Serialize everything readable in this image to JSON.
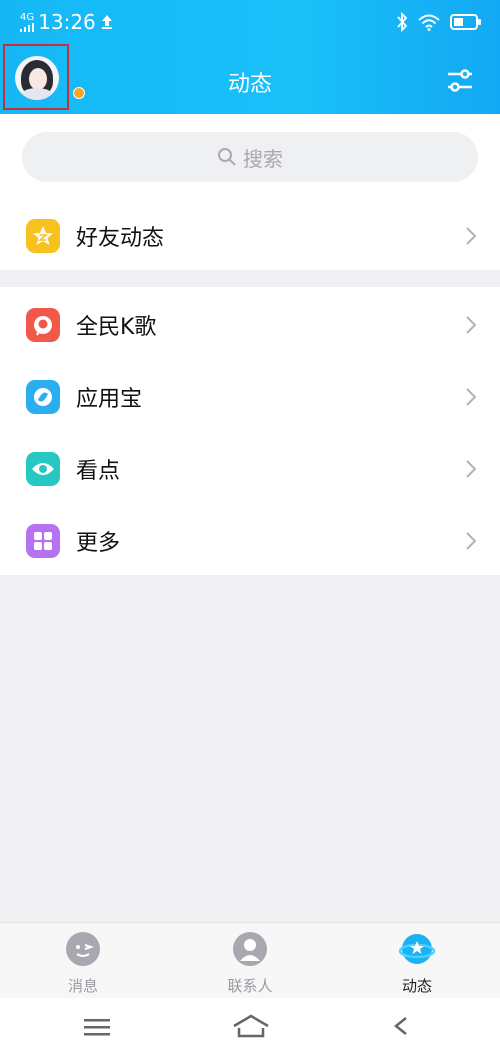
{
  "status_bar": {
    "network": "4G",
    "time": "13:26"
  },
  "header": {
    "title": "动态"
  },
  "search": {
    "placeholder": "搜索"
  },
  "sections": [
    {
      "items": [
        {
          "label": "好友动态",
          "icon": "qzone-star-icon",
          "color": "#f7c21e"
        }
      ]
    },
    {
      "items": [
        {
          "label": "全民K歌",
          "icon": "karaoke-icon",
          "color": "#f2584a"
        },
        {
          "label": "应用宝",
          "icon": "app-store-icon",
          "color": "#2aaef0"
        },
        {
          "label": "看点",
          "icon": "eye-icon",
          "color": "#26c8c1"
        },
        {
          "label": "更多",
          "icon": "grid-more-icon",
          "color": "#b772f0"
        }
      ]
    }
  ],
  "tabbar": {
    "tabs": [
      {
        "label": "消息",
        "icon": "message-icon",
        "active": false
      },
      {
        "label": "联系人",
        "icon": "contacts-icon",
        "active": false
      },
      {
        "label": "动态",
        "icon": "planet-icon",
        "active": true
      }
    ]
  },
  "colors": {
    "accent": "#16b6f5",
    "divider": "#f0f0f2"
  }
}
